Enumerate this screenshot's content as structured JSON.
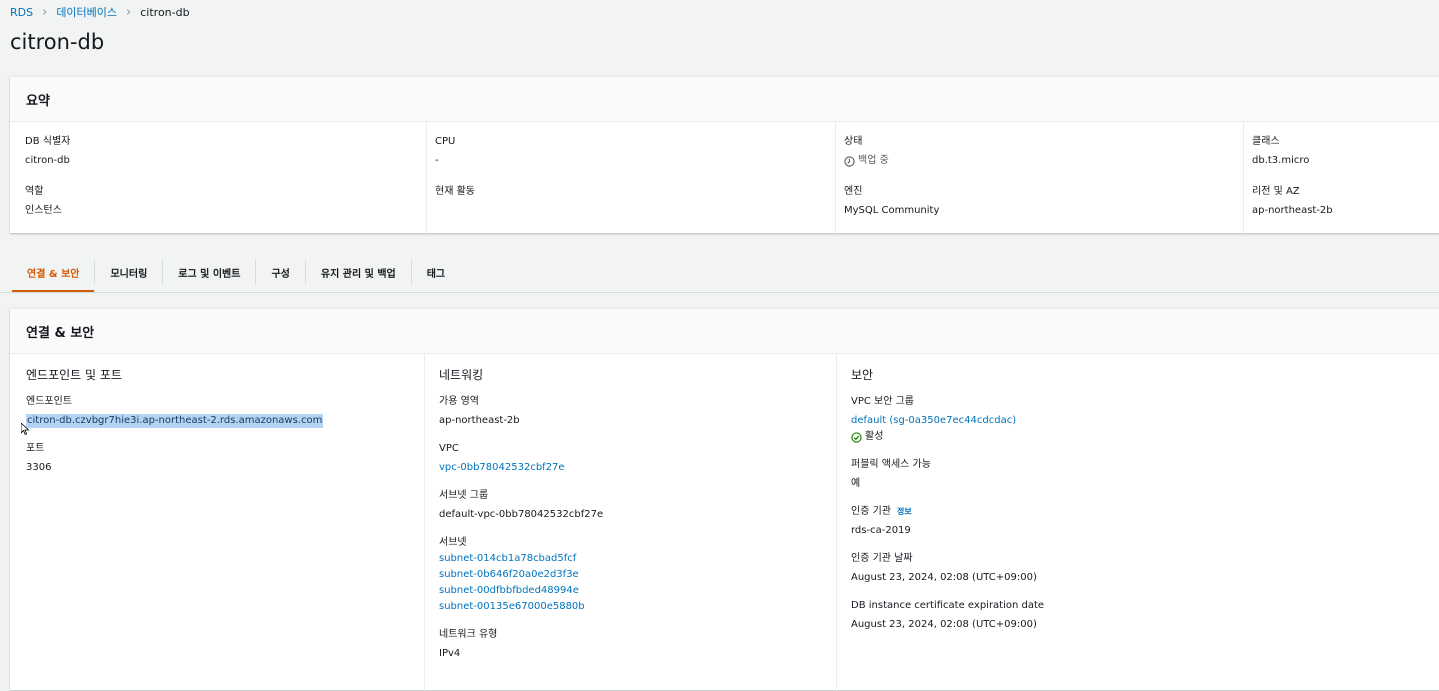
{
  "breadcrumb": {
    "root": "RDS",
    "parent": "데이터베이스",
    "current": "citron-db"
  },
  "page_title": "citron-db",
  "summary": {
    "title": "요약",
    "col1": {
      "f1_label": "DB 식별자",
      "f1_value": "citron-db",
      "f2_label": "역할",
      "f2_value": "인스턴스"
    },
    "col2": {
      "f1_label": "CPU",
      "f1_value": "-",
      "f2_label": "현재 활동",
      "f2_value": ""
    },
    "col3": {
      "f1_label": "상태",
      "f1_value": "백업 중",
      "f2_label": "엔진",
      "f2_value": "MySQL Community"
    },
    "col4": {
      "f1_label": "클래스",
      "f1_value": "db.t3.micro",
      "f2_label": "리전 및 AZ",
      "f2_value": "ap-northeast-2b"
    }
  },
  "tabs": [
    "연결 & 보안",
    "모니터링",
    "로그 및 이벤트",
    "구성",
    "유지 관리 및 백업",
    "태그"
  ],
  "connectivity": {
    "title": "연결 & 보안",
    "endpoint_section": {
      "title": "엔드포인트 및 포트",
      "endpoint_label": "엔드포인트",
      "endpoint_value": "citron-db.czvbgr7hie3i.ap-northeast-2.rds.amazonaws.com",
      "port_label": "포트",
      "port_value": "3306"
    },
    "networking": {
      "title": "네트워킹",
      "az_label": "가용 영역",
      "az_value": "ap-northeast-2b",
      "vpc_label": "VPC",
      "vpc_value": "vpc-0bb78042532cbf27e",
      "subnet_group_label": "서브넷 그룹",
      "subnet_group_value": "default-vpc-0bb78042532cbf27e",
      "subnets_label": "서브넷",
      "subnets": [
        "subnet-014cb1a78cbad5fcf",
        "subnet-0b646f20a0e2d3f3e",
        "subnet-00dfbbfbded48994e",
        "subnet-00135e67000e5880b"
      ],
      "network_type_label": "네트워크 유형",
      "network_type_value": "IPv4"
    },
    "security": {
      "title": "보안",
      "sg_label": "VPC 보안 그룹",
      "sg_value": "default (sg-0a350e7ec44cdcdac)",
      "sg_status": "활성",
      "public_label": "퍼블릭 액세스 가능",
      "public_value": "예",
      "ca_label": "인증 기관",
      "ca_info": "정보",
      "ca_value": "rds-ca-2019",
      "ca_date_label": "인증 기관 날짜",
      "ca_date_value": "August 23, 2024, 02:08 (UTC+09:00)",
      "cert_exp_label": "DB instance certificate expiration date",
      "cert_exp_value": "August 23, 2024, 02:08 (UTC+09:00)"
    }
  },
  "colors": {
    "link": "#0073bb",
    "active_tab": "#d45b07",
    "success": "#1d8102"
  }
}
